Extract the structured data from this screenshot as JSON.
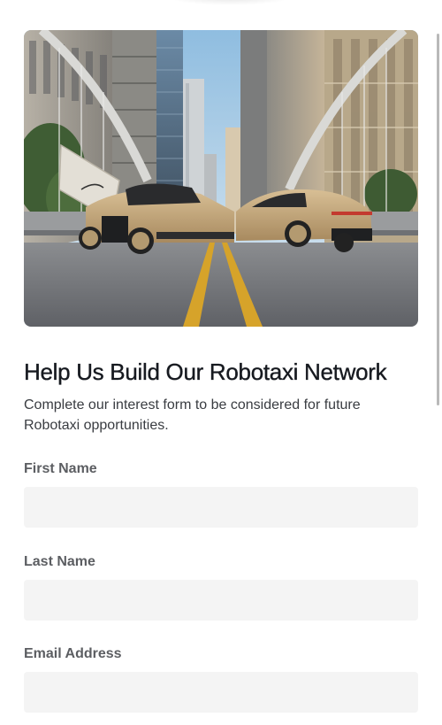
{
  "hero": {
    "image_name": "robotaxi-cybercab-hero",
    "colors": {
      "car_body": "#c8ab7f",
      "road": "#6e7076",
      "road_line": "#d7a526",
      "sky": "#9cc4e2"
    }
  },
  "form": {
    "title": "Help Us Build Our Robotaxi Network",
    "subtitle": "Complete our interest form to be considered for future Robotaxi opportunities.",
    "fields": [
      {
        "label": "First Name",
        "value": "",
        "placeholder": ""
      },
      {
        "label": "Last Name",
        "value": "",
        "placeholder": ""
      },
      {
        "label": "Email Address",
        "value": "",
        "placeholder": ""
      }
    ]
  },
  "colors": {
    "title": "#171a20",
    "body_text": "#393c41",
    "label": "#5c5e62",
    "input_bg": "#f4f4f4",
    "scrollbar": "#b9b9b9"
  }
}
